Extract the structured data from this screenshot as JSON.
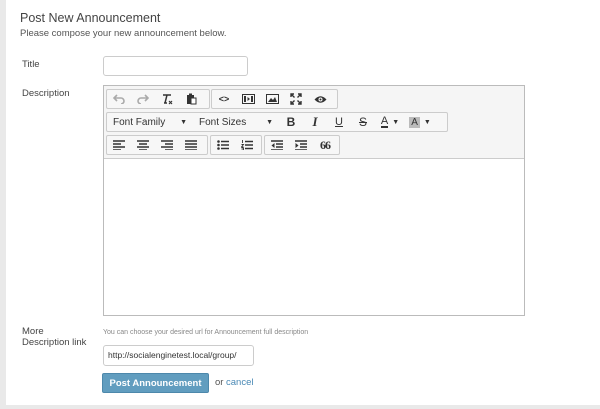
{
  "form": {
    "title": "Post New Announcement",
    "subtitle": "Please compose your new announcement below.",
    "title_label": "Title",
    "title_value": "",
    "description_label": "Description",
    "more_label_line1": "More",
    "more_label_line2": "Description link",
    "more_hint": "You can choose your desired url for Announcement full description",
    "url_value": "http://socialenginetest.local/group/",
    "submit_label": "Post Announcement",
    "or_text": "or",
    "cancel_label": "cancel"
  },
  "editor": {
    "font_family_label": "Font Family",
    "font_sizes_label": "Font Sizes",
    "bold_label": "B",
    "italic_label": "I",
    "underline_label": "U",
    "strike_label": "S",
    "text_color_label": "A",
    "bg_color_label": "A",
    "quote_label": "66",
    "code_label": "<>",
    "toolbar_icons": [
      "undo-icon",
      "redo-icon",
      "clear-format-icon",
      "paste-icon",
      "code-icon",
      "media-icon",
      "image-icon",
      "fullscreen-icon",
      "preview-icon",
      "align-left-icon",
      "align-center-icon",
      "align-right-icon",
      "justify-icon",
      "bullet-list-icon",
      "numbered-list-icon",
      "outdent-icon",
      "indent-icon",
      "blockquote-icon"
    ]
  },
  "colors": {
    "accent": "#619dbf",
    "link": "#4a89b5",
    "background": "#e9e9e9"
  }
}
